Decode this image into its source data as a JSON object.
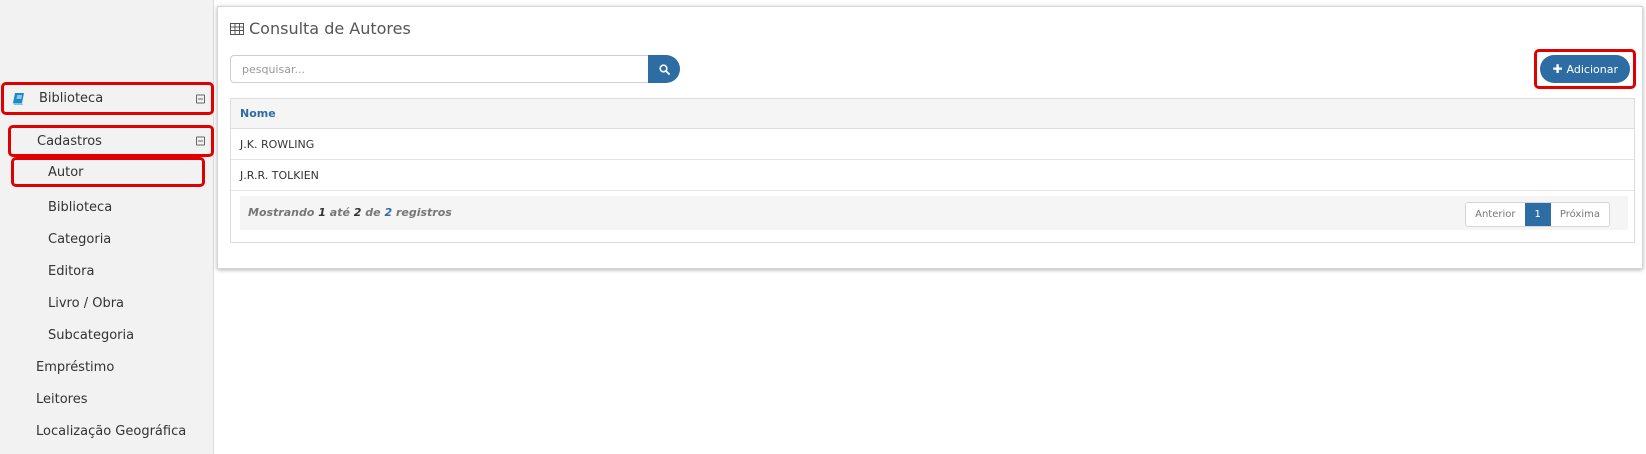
{
  "sidebar": {
    "biblioteca": "Biblioteca",
    "cadastros": "Cadastros",
    "items": [
      "Autor",
      "Biblioteca",
      "Categoria",
      "Editora",
      "Livro / Obra",
      "Subcategoria"
    ],
    "emprestimo": "Empréstimo",
    "leitores": "Leitores",
    "localizacao": "Localização Geográfica"
  },
  "panel": {
    "title": "Consulta de Autores",
    "search_placeholder": "pesquisar...",
    "add_label": "Adicionar"
  },
  "table": {
    "header": "Nome",
    "rows": [
      "J.K. ROWLING",
      "J.R.R. TOLKIEN"
    ]
  },
  "footer": {
    "info_prefix": "Mostrando",
    "from": "1",
    "until_word": "até",
    "to": "2",
    "of_word": "de",
    "total": "2",
    "records_word": "registros"
  },
  "pager": {
    "prev": "Anterior",
    "page": "1",
    "next": "Próxima"
  },
  "colors": {
    "primary": "#2e6da4",
    "highlight": "#e00000",
    "book_icon": "#1a8bc6"
  }
}
